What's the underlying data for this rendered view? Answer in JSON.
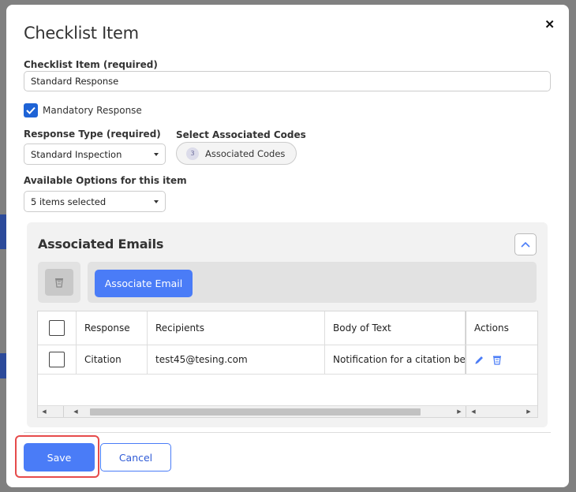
{
  "modal": {
    "title": "Checklist Item",
    "close_glyph": "✕"
  },
  "form": {
    "item_label": "Checklist Item (required)",
    "item_value": "Standard Response",
    "mandatory_label": "Mandatory Response",
    "mandatory_checked": true,
    "response_type_label": "Response Type (required)",
    "response_type_value": "Standard Inspection",
    "codes_label": "Select Associated Codes",
    "codes_count": "3",
    "codes_button": "Associated Codes",
    "options_label": "Available Options for this item",
    "options_value": "5 items selected"
  },
  "emails": {
    "title": "Associated Emails",
    "associate_button": "Associate Email",
    "columns": [
      "Response",
      "Recipients",
      "Body of Text",
      "Actions"
    ],
    "rows": [
      {
        "response": "Citation",
        "recipients": "test45@tesing.com",
        "body": "Notification for a citation being"
      }
    ]
  },
  "footer": {
    "save": "Save",
    "cancel": "Cancel"
  },
  "colors": {
    "primary": "#4a7cf7",
    "highlight": "#e64b4b",
    "checkbox": "#1e63d6"
  }
}
